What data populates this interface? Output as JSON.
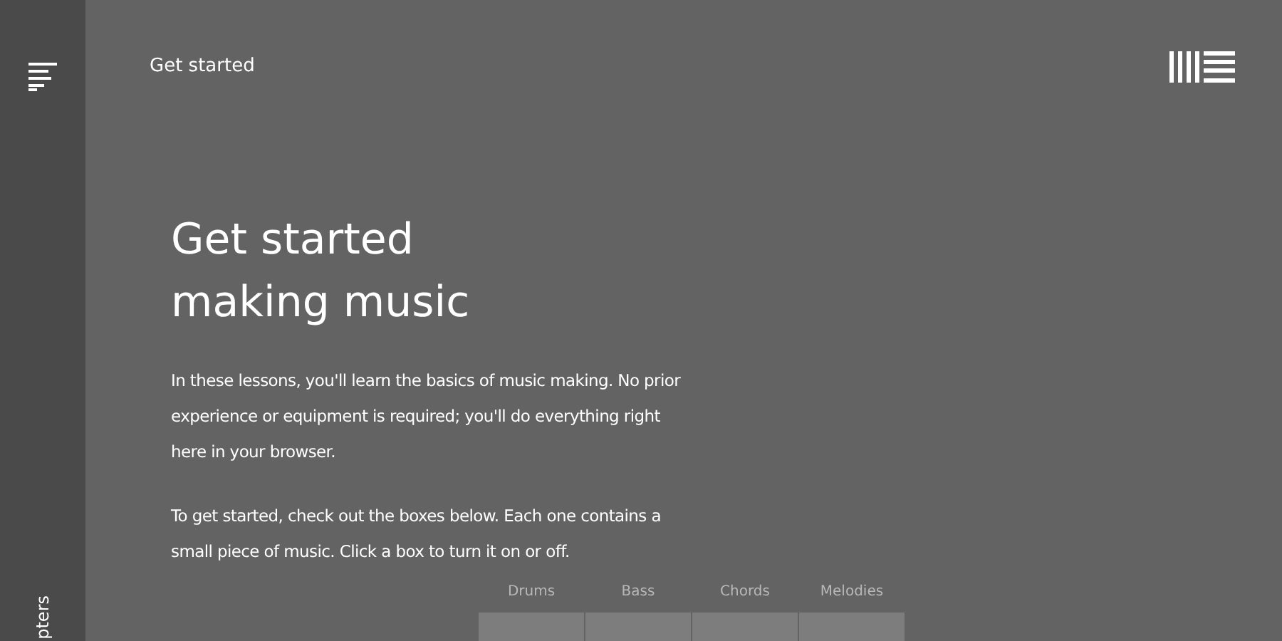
{
  "sidebar": {
    "vertical_label": "pters"
  },
  "header": {
    "title": "Get started"
  },
  "hero": {
    "heading_lines": [
      "Get started",
      "making music"
    ],
    "paragraphs": [
      "In these lessons, you'll learn the basics of music making. No prior experience or equipment is required; you'll do everything right here in your browser.",
      "To get started, check out the boxes below. Each one contains a small piece of music. Click a box to turn it on or off."
    ]
  },
  "pads": [
    {
      "label": "Drums"
    },
    {
      "label": "Bass"
    },
    {
      "label": "Chords"
    },
    {
      "label": "Melodies"
    }
  ]
}
